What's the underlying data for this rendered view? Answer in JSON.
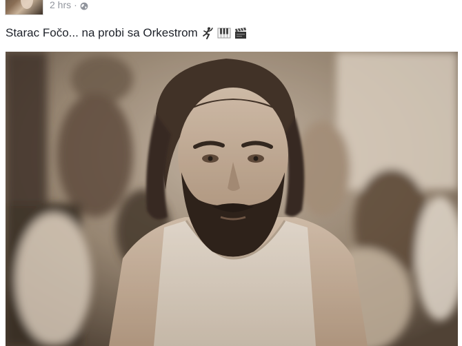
{
  "post": {
    "timestamp": "2 hrs",
    "separator": "·",
    "privacy_icon": "globe-icon",
    "text": "Starac Fočo... na probi sa Orkestrom",
    "emojis": [
      "dancer-emoji",
      "piano-keys-emoji",
      "clapper-board-emoji"
    ],
    "photo_icon": "bearded-man-photo"
  },
  "colors": {
    "meta_text": "#90949c",
    "body_text": "#1d2129",
    "photo_tone": "#8a7a68"
  }
}
